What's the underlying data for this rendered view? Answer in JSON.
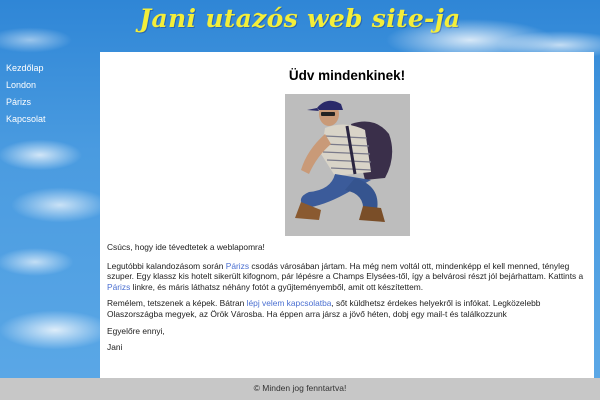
{
  "header": {
    "title": "Jani utazós web site-ja"
  },
  "nav": {
    "items": [
      {
        "label": "Kezdőlap"
      },
      {
        "label": "London"
      },
      {
        "label": "Párizs"
      },
      {
        "label": "Kapcsolat"
      }
    ]
  },
  "main": {
    "heading": "Üdv mindenkinek!",
    "p1": "Csúcs, hogy ide tévedtetek a weblapomra!",
    "p2": {
      "before": "Legutóbbi kalandozásom során ",
      "link": "Párizs",
      "after": " csodás városában jártam. Ha még nem voltál ott, mindenképp el kell menned, tényleg szuper. Egy klassz kis hotelt sikerült kifognom, pár lépésre a Champs Elysées-től, így a belvárosi részt jól bejárhattam. Kattints a ",
      "link2": "Párizs",
      "after2": " linkre, és máris láthatsz néhány fotót a gyűjteményemből, amit ott készítettem."
    },
    "p3": {
      "before": "Remélem, tetszenek a képek. Bátran ",
      "link": "lépj velem kapcsolatba",
      "after": ", sőt küldhetsz érdekes helyekről is infókat. Legközelebb Olaszországba megyek, az Örök Városba. Ha éppen arra jársz a jövő héten, dobj egy mail-t és találkozzunk"
    },
    "p4": "Egyelőre ennyi,",
    "p5": "Jani"
  },
  "footer": {
    "text": "© Minden jog fenntartva!"
  },
  "colors": {
    "title": "#f3ee3a",
    "sky": "#4a9be0",
    "link": "#4a6fd1",
    "footer": "#c7c7c7"
  }
}
